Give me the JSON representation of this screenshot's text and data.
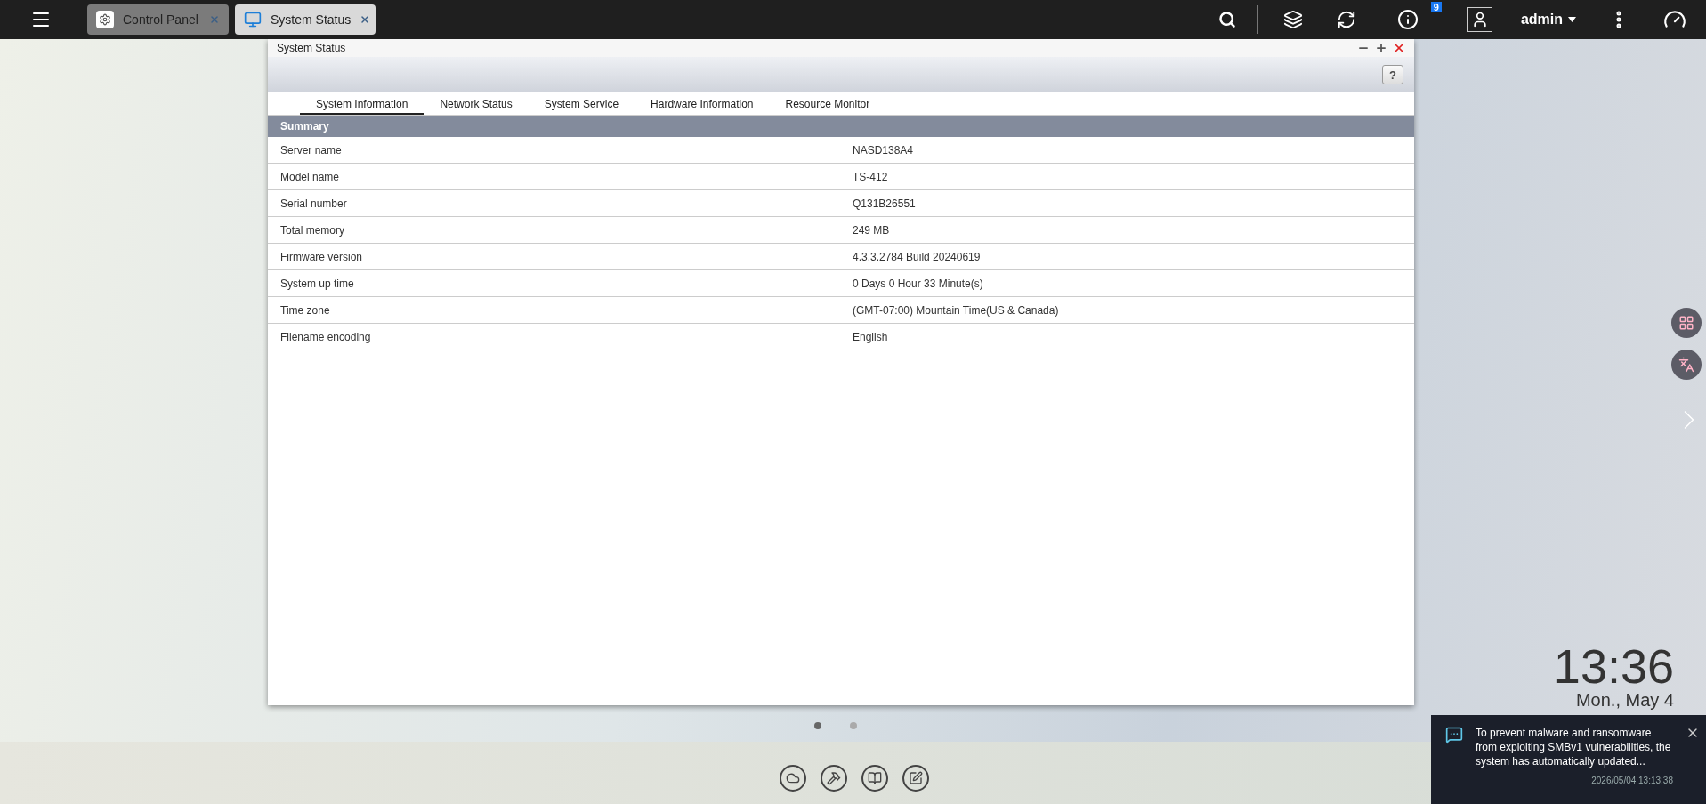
{
  "top_bar": {
    "tabs": [
      {
        "label": "Control Panel",
        "kind": "gear",
        "selected": false
      },
      {
        "label": "System Status",
        "kind": "monitor",
        "selected": true
      }
    ],
    "notification_count": "9",
    "user": "admin"
  },
  "window": {
    "title": "System Status",
    "help": "?",
    "tabs": [
      {
        "label": "System Information",
        "selected": true
      },
      {
        "label": "Network Status",
        "selected": false
      },
      {
        "label": "System Service",
        "selected": false
      },
      {
        "label": "Hardware Information",
        "selected": false
      },
      {
        "label": "Resource Monitor",
        "selected": false
      }
    ],
    "section": "Summary",
    "rows": [
      {
        "label": "Server name",
        "value": "NASD138A4"
      },
      {
        "label": "Model name",
        "value": "TS-412"
      },
      {
        "label": "Serial number",
        "value": "Q131B26551"
      },
      {
        "label": "Total memory",
        "value": "249 MB"
      },
      {
        "label": "Firmware version",
        "value": "4.3.3.2784 Build 20240619"
      },
      {
        "label": "System up time",
        "value": "0 Days 0 Hour 33 Minute(s)"
      },
      {
        "label": "Time zone",
        "value": "(GMT-07:00) Mountain Time(US & Canada)"
      },
      {
        "label": "Filename encoding",
        "value": "English"
      }
    ]
  },
  "pager": [
    {
      "selected": true
    },
    {
      "selected": false
    }
  ],
  "clock": {
    "time": "13:36",
    "date": "Mon., May 4"
  },
  "notification": {
    "message": "To prevent malware and ransomware from exploiting SMBv1 vulnerabilities, the system has automatically updated...",
    "time": "2026/05/04 13:13:38"
  }
}
